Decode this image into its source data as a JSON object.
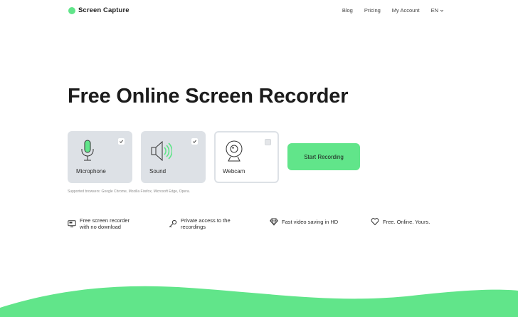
{
  "brand": {
    "name": "Screen Capture",
    "accent": "#61e58a"
  },
  "nav": {
    "links": [
      "Blog",
      "Pricing",
      "My Account"
    ],
    "language": "EN",
    "language_icon": "chevron-down-icon"
  },
  "hero": {
    "title": "Free Online Screen Recorder"
  },
  "options": [
    {
      "label": "Microphone",
      "icon": "microphone-icon",
      "checked": true
    },
    {
      "label": "Sound",
      "icon": "speaker-icon",
      "checked": true
    },
    {
      "label": "Webcam",
      "icon": "webcam-icon",
      "checked": false
    }
  ],
  "start_button": {
    "label": "Start Recording"
  },
  "supported_browsers": "Supported browsers: Google Chrome, Mozilla Firefox, Microsoft Edge, Opera.",
  "features": [
    {
      "icon": "monitor-icon",
      "text": "Free screen recorder\nwith no download"
    },
    {
      "icon": "key-icon",
      "text": "Private access to the\nrecordings"
    },
    {
      "icon": "diamond-icon",
      "text": "Fast video saving in HD"
    },
    {
      "icon": "heart-icon",
      "text": "Free. Online. Yours."
    }
  ]
}
